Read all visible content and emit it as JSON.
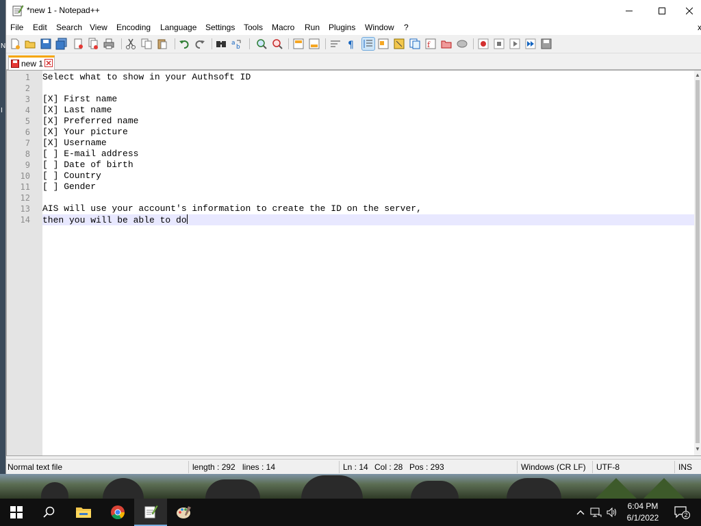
{
  "window": {
    "title": "*new 1 - Notepad++"
  },
  "menu": [
    "File",
    "Edit",
    "Search",
    "View",
    "Encoding",
    "Language",
    "Settings",
    "Tools",
    "Macro",
    "Run",
    "Plugins",
    "Window",
    "?"
  ],
  "tab": {
    "label": "new 1",
    "modified": true
  },
  "editor": {
    "lines": [
      "Select what to show in your Authsoft ID",
      "",
      "[X] First name",
      "[X] Last name",
      "[X] Preferred name",
      "[X] Your picture",
      "[X] Username",
      "[ ] E-mail address",
      "[ ] Date of birth",
      "[ ] Country",
      "[ ] Gender",
      "",
      "AIS will use your account's information to create the ID on the server,",
      "then you will be able to do"
    ],
    "current_line": 14
  },
  "status": {
    "file_type": "Normal text file",
    "length": "length : 292",
    "lines": "lines : 14",
    "ln": "Ln : 14",
    "col": "Col : 28",
    "pos": "Pos : 293",
    "eol": "Windows (CR LF)",
    "encoding": "UTF-8",
    "mode": "INS"
  },
  "taskbar": {
    "time": "6:04 PM",
    "date": "6/1/2022",
    "notification_count": "2"
  },
  "colors": {
    "tab_accent": "#f6a500",
    "current_line_bg": "#e8e8ff",
    "gutter_bg": "#e4e4e4",
    "taskbar_bg": "#101010"
  }
}
